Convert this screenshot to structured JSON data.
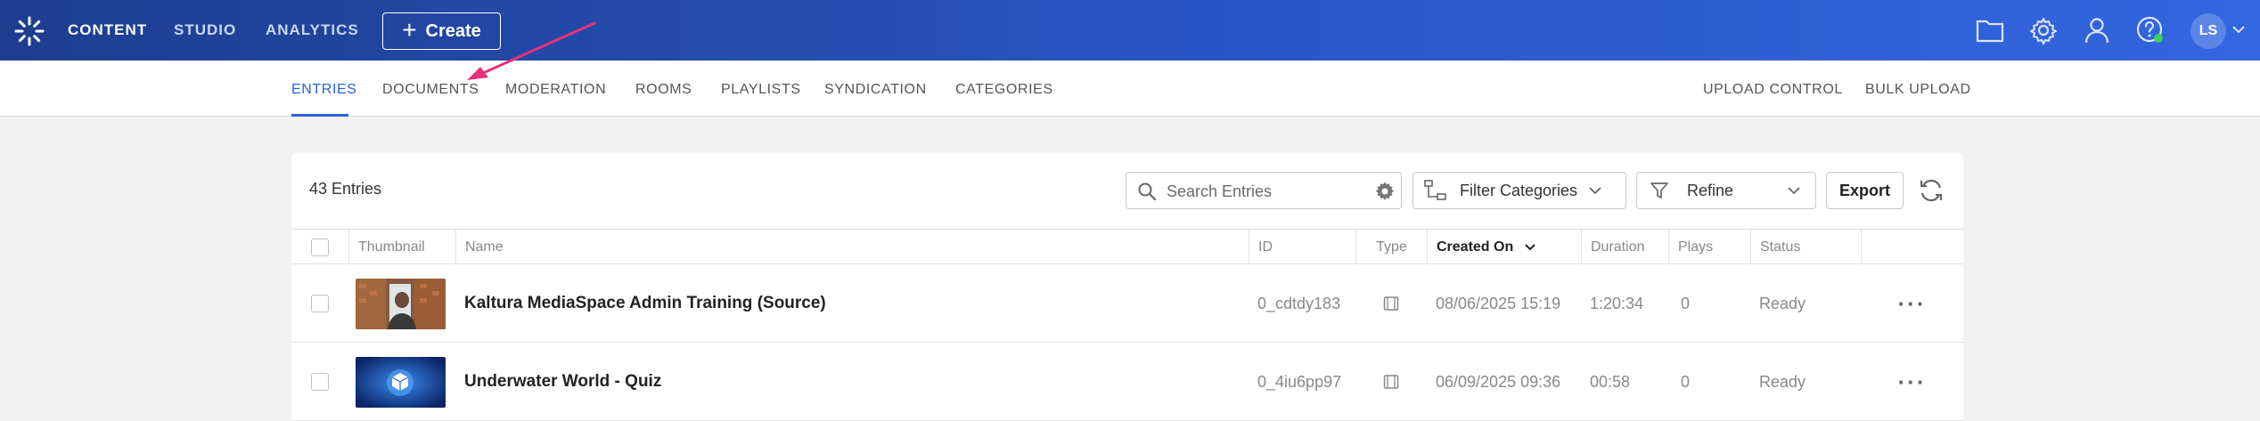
{
  "topbar": {
    "nav": [
      "CONTENT",
      "STUDIO",
      "ANALYTICS"
    ],
    "create_label": "Create",
    "avatar_initials": "LS",
    "icons": [
      "folder-icon",
      "gear-icon",
      "user-icon",
      "help-icon"
    ],
    "colors": {
      "bar_start": "#1d3e8e",
      "bar_end": "#3466e0",
      "online_dot": "#3ecf5a"
    }
  },
  "subnav": {
    "tabs": [
      "ENTRIES",
      "DOCUMENTS",
      "MODERATION",
      "ROOMS",
      "PLAYLISTS",
      "SYNDICATION",
      "CATEGORIES"
    ],
    "active_tab": "ENTRIES",
    "right_links": [
      "UPLOAD CONTROL",
      "BULK UPLOAD"
    ],
    "accent": "#2a60d6"
  },
  "toolbar": {
    "count": "43 Entries",
    "search_placeholder": "Search Entries",
    "filter_categories_label": "Filter Categories",
    "refine_label": "Refine",
    "export_label": "Export"
  },
  "table": {
    "columns": [
      "Thumbnail",
      "Name",
      "ID",
      "Type",
      "Created On",
      "Duration",
      "Plays",
      "Status"
    ],
    "sorted_column": "Created On",
    "rows": [
      {
        "name": "Kaltura MediaSpace Admin Training (Source)",
        "id": "0_cdtdy183",
        "type_icon": "video-icon",
        "created_on": "08/06/2025 15:19",
        "duration": "1:20:34",
        "plays": "0",
        "status": "Ready"
      },
      {
        "name": "Underwater World - Quiz",
        "id": "0_4iu6pp97",
        "type_icon": "video-icon",
        "created_on": "06/09/2025 09:36",
        "duration": "00:58",
        "plays": "0",
        "status": "Ready"
      }
    ]
  },
  "annotation": {
    "arrow_color": "#e8327c"
  }
}
